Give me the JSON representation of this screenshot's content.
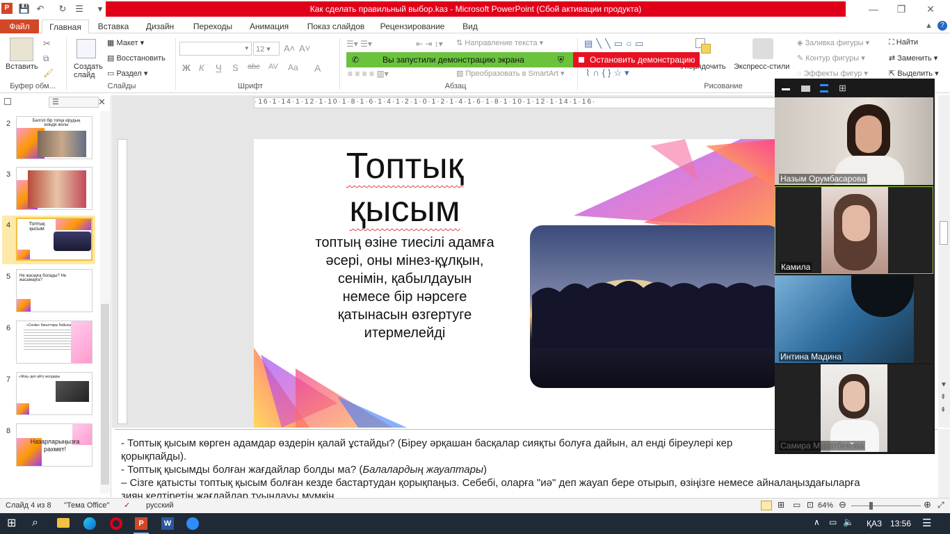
{
  "window": {
    "title": "Как сделать правильный выбор.kaз  -  Microsoft PowerPoint (Сбой активации продукта)",
    "app_logo_letter": "P"
  },
  "tabs": {
    "file": "Файл",
    "items": [
      "Главная",
      "Вставка",
      "Дизайн",
      "Переходы",
      "Анимация",
      "Показ слайдов",
      "Рецензирование",
      "Вид"
    ]
  },
  "ribbon": {
    "clipboard": {
      "paste": "Вставить",
      "group": "Буфер обм..."
    },
    "slides": {
      "create": "Создать слайд",
      "layout": "Макет",
      "restore": "Восстановить",
      "section": "Раздел",
      "group": "Слайды"
    },
    "font": {
      "size": "12",
      "group": "Шрифт"
    },
    "paragraph": {
      "text_direction": "Направление текста",
      "smartart": "Преобразовать в SmartArt",
      "group": "Абзац"
    },
    "drawing": {
      "arrange": "Упорядочить",
      "quick_styles": "Экспресс-стили",
      "fill": "Заливка фигуры",
      "outline": "Контур фигуры",
      "effects": "Эффекты фигур",
      "group": "Рисование"
    },
    "editing": {
      "find": "Найти",
      "replace": "Заменить",
      "select": "Выделить"
    }
  },
  "share_bar": {
    "started": "Вы запустили демонстрацию экрана",
    "stop": "Остановить демонстрацию"
  },
  "thumbnails": [
    {
      "num": "2",
      "text": "Белгілі бір топқа кірудың өзіндік жолы"
    },
    {
      "num": "3",
      "text": ""
    },
    {
      "num": "4",
      "text": "Топтық қысым"
    },
    {
      "num": "5",
      "text": "Не жасауға болады? Не жасамауға?"
    },
    {
      "num": "6",
      "text": "«Сенім» бағыттары бойынша"
    },
    {
      "num": "7",
      "text": "«Жоқ» деп айту жолдары"
    },
    {
      "num": "8",
      "text": "Назарларыңызға рахмет!"
    }
  ],
  "ruler": "·16·1·14·1·12·1·10·1·8·1·6·1·4·1·2·1·0·1·2·1·4·1·6·1·8·1·10·1·12·1·14·1·16·",
  "slide": {
    "title_line1": "Топтық",
    "title_line2": "қысым",
    "body": [
      "топтың өзіне тиесілі адамға",
      "әсері, оны мінез-құлқын,",
      "сенімін, қабылдауын",
      "немесе бір нәрсеге",
      "қатынасын өзгертуге",
      "итермелейді"
    ]
  },
  "notes": {
    "line1": "- Топтық қысым көрген адамдар өздерін қалай ұстайды? (Біреу әрқашан басқалар сияқты болуға дайын, ал енді біреулері кер",
    "line2": "қорықпайды).",
    "line3a": "-   Топтық қысымды болған жағдайлар болды ма? (",
    "line3b": "Балалардың жауаптары",
    "line3c": ")",
    "line4": "– Сізге қатысты топтық қысым болған кезде бастартудан қорықпаңыз. Себебі, оларға \"иә\" деп жауап бере отырып, өзіңізге немесе айналаңыздағыларға",
    "line5": "зиян келтіретін жағдайлар туындауы мүмкін."
  },
  "status": {
    "slide_of": "Слайд 4 из 8",
    "theme": "\"Тема Office\"",
    "language": "русский",
    "zoom": "64%"
  },
  "zoom_panel": {
    "participants": [
      "Назым Орумбасарова",
      "Камила",
      "Интина Мадина",
      "Самира Муратбекова"
    ]
  },
  "taskbar": {
    "language": "ҚАЗ",
    "time": "13:56"
  }
}
